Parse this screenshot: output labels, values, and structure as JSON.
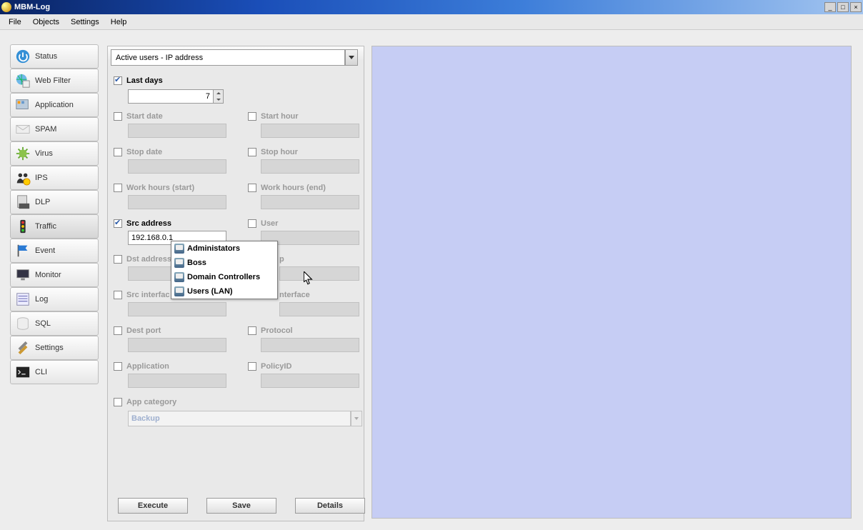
{
  "window": {
    "title": "MBM-Log"
  },
  "menubar": {
    "items": [
      "File",
      "Objects",
      "Settings",
      "Help"
    ]
  },
  "sidebar": {
    "items": [
      {
        "label": "Status",
        "icon": "power"
      },
      {
        "label": "Web Filter",
        "icon": "globe"
      },
      {
        "label": "Application",
        "icon": "apps"
      },
      {
        "label": "SPAM",
        "icon": "mail"
      },
      {
        "label": "Virus",
        "icon": "gear"
      },
      {
        "label": "IPS",
        "icon": "people"
      },
      {
        "label": "DLP",
        "icon": "doc"
      },
      {
        "label": "Traffic",
        "icon": "traffic",
        "selected": true
      },
      {
        "label": "Event",
        "icon": "flag"
      },
      {
        "label": "Monitor",
        "icon": "monitor"
      },
      {
        "label": "Log",
        "icon": "list"
      },
      {
        "label": "SQL",
        "icon": "db"
      },
      {
        "label": "Settings",
        "icon": "tools"
      },
      {
        "label": "CLI",
        "icon": "term"
      }
    ]
  },
  "form": {
    "report_type": "Active users - IP address",
    "last_days": {
      "checked": true,
      "label": "Last days",
      "value": "7"
    },
    "start_date": {
      "checked": false,
      "label": "Start date"
    },
    "start_hour": {
      "checked": false,
      "label": "Start hour"
    },
    "stop_date": {
      "checked": false,
      "label": "Stop date"
    },
    "stop_hour": {
      "checked": false,
      "label": "Stop hour"
    },
    "work_start": {
      "checked": false,
      "label": "Work hours (start)"
    },
    "work_end": {
      "checked": false,
      "label": "Work hours (end)"
    },
    "src_addr": {
      "checked": true,
      "label": "Src address",
      "value": "192.168.0.1"
    },
    "user": {
      "checked": false,
      "label": "User"
    },
    "dst_addr": {
      "checked": false,
      "label": "Dst address"
    },
    "group": {
      "checked": false,
      "label": "Group",
      "partial_label": "p"
    },
    "src_if": {
      "checked": false,
      "label": "Src interface",
      "truncated": "Src interfac"
    },
    "dst_if": {
      "checked": false,
      "label": "Dst interface",
      "truncated": "nterface"
    },
    "dest_port": {
      "checked": false,
      "label": "Dest port"
    },
    "protocol": {
      "checked": false,
      "label": "Protocol"
    },
    "application": {
      "checked": false,
      "label": "Application"
    },
    "policyid": {
      "checked": false,
      "label": "PolicyID"
    },
    "app_category": {
      "checked": false,
      "label": "App category",
      "value": "Backup"
    }
  },
  "popup": {
    "items": [
      "Administators",
      "Boss",
      "Domain Controllers",
      "Users (LAN)"
    ]
  },
  "buttons": {
    "execute": "Execute",
    "save": "Save",
    "details": "Details"
  }
}
